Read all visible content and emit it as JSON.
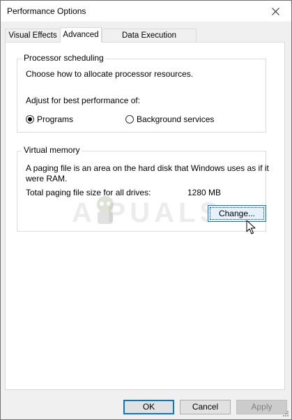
{
  "window": {
    "title": "Performance Options",
    "close_glyph": "×"
  },
  "tabs": [
    {
      "label": "Visual Effects",
      "selected": false
    },
    {
      "label": "Advanced",
      "selected": true
    },
    {
      "label": "Data Execution Prevention",
      "selected": false
    }
  ],
  "processor_scheduling": {
    "title": "Processor scheduling",
    "description": "Choose how to allocate processor resources.",
    "adjust_label": "Adjust for best performance of:",
    "options": [
      {
        "label": "Programs",
        "checked": true
      },
      {
        "label": "Background services",
        "checked": false
      }
    ]
  },
  "virtual_memory": {
    "title": "Virtual memory",
    "description_line1": "A paging file is an area on the hard disk that Windows uses as if it",
    "description_line2": "were RAM.",
    "total_label": "Total paging file size for all drives:",
    "total_value": "1280 MB",
    "change_button": "Change..."
  },
  "watermark": {
    "text": "A  PUALS"
  },
  "buttons": {
    "ok": "OK",
    "cancel": "Cancel",
    "apply": "Apply"
  },
  "icons": {
    "close": "close-icon",
    "cursor": "mouse-pointer-icon",
    "size_grip": "size-grip-icon"
  },
  "colors": {
    "accent": "#0078d7",
    "window_bg": "#f0f0f0",
    "panel_bg": "#ffffff"
  }
}
